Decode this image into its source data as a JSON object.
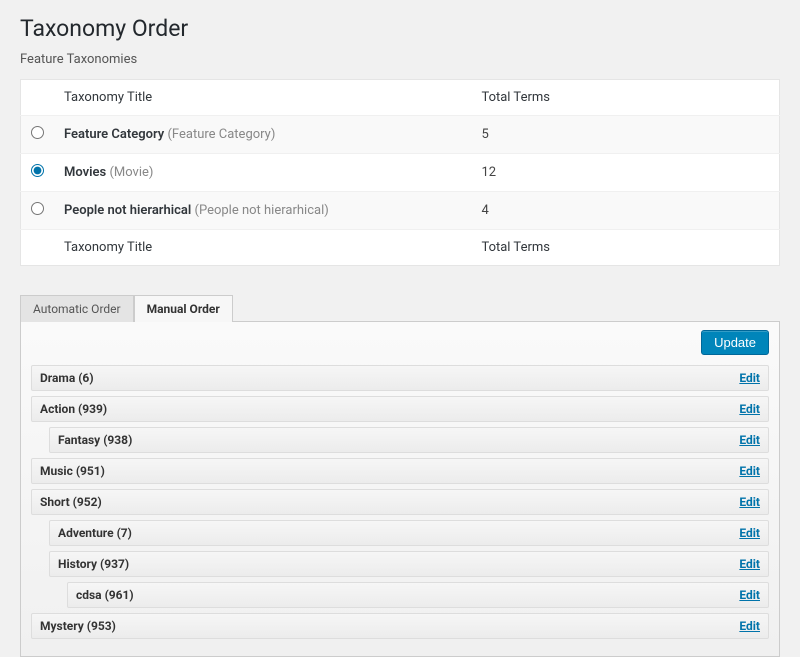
{
  "page": {
    "title": "Taxonomy Order",
    "subheading": "Feature Taxonomies"
  },
  "table": {
    "headers": {
      "title": "Taxonomy Title",
      "terms": "Total Terms"
    },
    "rows": [
      {
        "name": "Feature Category",
        "slug": "(Feature Category)",
        "count": "5",
        "selected": false
      },
      {
        "name": "Movies",
        "slug": "(Movie)",
        "count": "12",
        "selected": true
      },
      {
        "name": "People not hierarhical",
        "slug": "(People not hierarhical)",
        "count": "4",
        "selected": false
      }
    ],
    "footers": {
      "title": "Taxonomy Title",
      "terms": "Total Terms"
    }
  },
  "tabs": {
    "auto": "Automatic Order",
    "manual": "Manual Order",
    "active": "manual"
  },
  "toolbar": {
    "update": "Update"
  },
  "editLabel": "Edit",
  "terms": [
    {
      "label": "Drama",
      "count": "6",
      "indent": 0
    },
    {
      "label": "Action",
      "count": "939",
      "indent": 0
    },
    {
      "label": "Fantasy",
      "count": "938",
      "indent": 1
    },
    {
      "label": "Music",
      "count": "951",
      "indent": 0
    },
    {
      "label": "Short",
      "count": "952",
      "indent": 0
    },
    {
      "label": "Adventure",
      "count": "7",
      "indent": 1
    },
    {
      "label": "History",
      "count": "937",
      "indent": 1
    },
    {
      "label": "cdsa",
      "count": "961",
      "indent": 2
    },
    {
      "label": "Mystery",
      "count": "953",
      "indent": 0
    }
  ]
}
